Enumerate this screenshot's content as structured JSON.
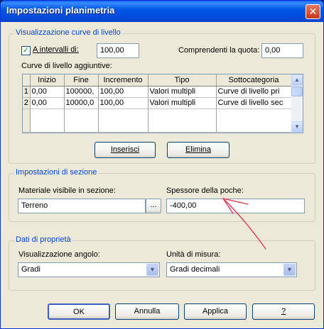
{
  "window": {
    "title": "Impostazioni planimetria",
    "close_glyph": "✕"
  },
  "contours": {
    "group_title": "Visualizzazione curve di livello",
    "interval_check_label": "A intervalli di:",
    "interval_value": "100,00",
    "elevation_label": "Comprendenti la quota:",
    "elevation_value": "0,00",
    "additional_label": "Curve di livello aggiuntive:",
    "table": {
      "columns": [
        "Inizio",
        "Fine",
        "Incremento",
        "Tipo",
        "Sottocategoria"
      ],
      "rows": [
        {
          "num": "1",
          "cells": [
            "0,00",
            "100000,",
            "100,00",
            "Valori multipli",
            "Curve di livello pri"
          ]
        },
        {
          "num": "2",
          "cells": [
            "0,00",
            "10000,0",
            "100,00",
            "Valori multipli",
            "Curve di livello sec"
          ]
        }
      ]
    },
    "insert_button": "Inserisci",
    "delete_button": "Elimina"
  },
  "section": {
    "group_title": "Impostazioni di sezione",
    "material_label": "Materiale visibile in sezione:",
    "material_value": "Terreno",
    "browse_button": "...",
    "poche_label": "Spessore della poche:",
    "poche_value": "-400,00"
  },
  "properties": {
    "group_title": "Dati di proprietà",
    "angle_label": "Visualizzazione angolo:",
    "angle_value": "Gradi",
    "units_label": "Unità di misura:",
    "units_value": "Gradi decimali"
  },
  "footer": {
    "ok_button": "OK",
    "cancel_button": "Annulla",
    "apply_button": "Applica",
    "help_button": "?"
  },
  "annotation": {
    "arrow_color": "#e0304a"
  }
}
